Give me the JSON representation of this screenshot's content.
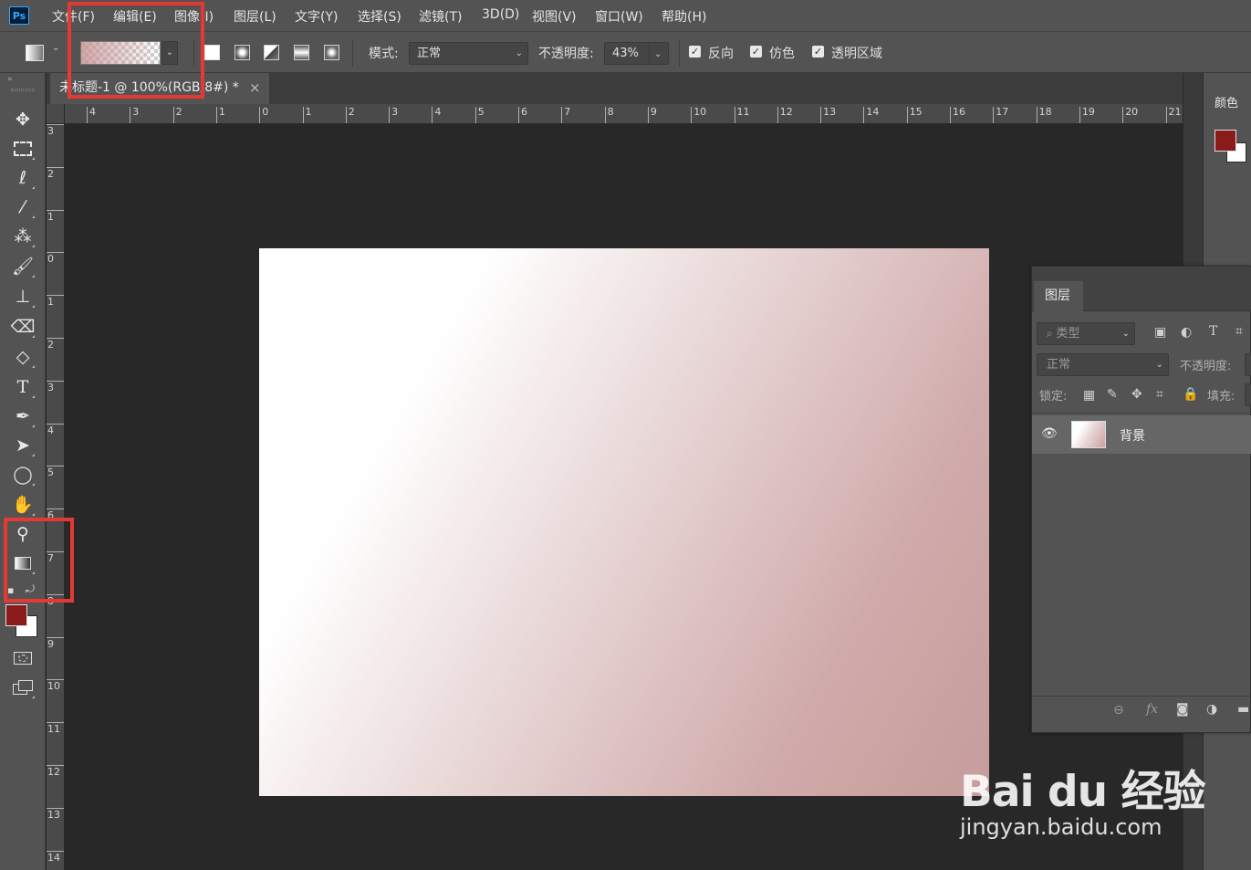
{
  "app": {
    "logo": "Ps"
  },
  "menu": [
    "文件(F)",
    "编辑(E)",
    "图像(I)",
    "图层(L)",
    "文字(Y)",
    "选择(S)",
    "滤镜(T)",
    "3D(D)",
    "视图(V)",
    "窗口(W)",
    "帮助(H)"
  ],
  "options": {
    "mode_label": "模式:",
    "mode_value": "正常",
    "opacity_label": "不透明度:",
    "opacity_value": "43%",
    "reverse_label": "反向",
    "dither_label": "仿色",
    "transparency_label": "透明区域",
    "reverse_checked": true,
    "dither_checked": true,
    "transparency_checked": true
  },
  "document": {
    "tab_title": "未标题-1 @ 100%(RGB/8#) *",
    "close_glyph": "×"
  },
  "ruler_top": [
    "4",
    "3",
    "2",
    "1",
    "0",
    "1",
    "2",
    "3",
    "4",
    "5",
    "6",
    "7",
    "8",
    "9",
    "10",
    "11",
    "12",
    "13",
    "14",
    "15",
    "16",
    "17",
    "18",
    "19",
    "20",
    "21"
  ],
  "ruler_left": [
    "3",
    "2",
    "1",
    "0",
    "1",
    "2",
    "3",
    "4",
    "5",
    "6",
    "7",
    "8",
    "9",
    "10",
    "11",
    "12",
    "13",
    "14"
  ],
  "color_panel": {
    "title": "颜色",
    "foreground": "#8b1a1a",
    "background": "#ffffff"
  },
  "layers_panel": {
    "tab": "图层",
    "filter_placeholder": "类型",
    "blend_mode": "正常",
    "opacity_label": "不透明度:",
    "lock_label": "锁定:",
    "fill_label": "填充:",
    "layers": [
      {
        "name": "背景",
        "visible": true
      }
    ]
  },
  "toolbar": {
    "tools": [
      "move-tool",
      "marquee-tool",
      "lasso-tool",
      "magic-wand-tool",
      "eyedropper-tool",
      "brush-tool",
      "stamp-tool",
      "eraser-tool",
      "paint-bucket-tool",
      "type-tool",
      "pen-tool",
      "path-select-tool",
      "ellipse-tool",
      "hand-tool",
      "zoom-tool",
      "gradient-tool"
    ],
    "foreground": "#8b1a1a",
    "background": "#ffffff"
  },
  "watermark": {
    "logo": "Bai du 经验",
    "url": "jingyan.baidu.com"
  }
}
